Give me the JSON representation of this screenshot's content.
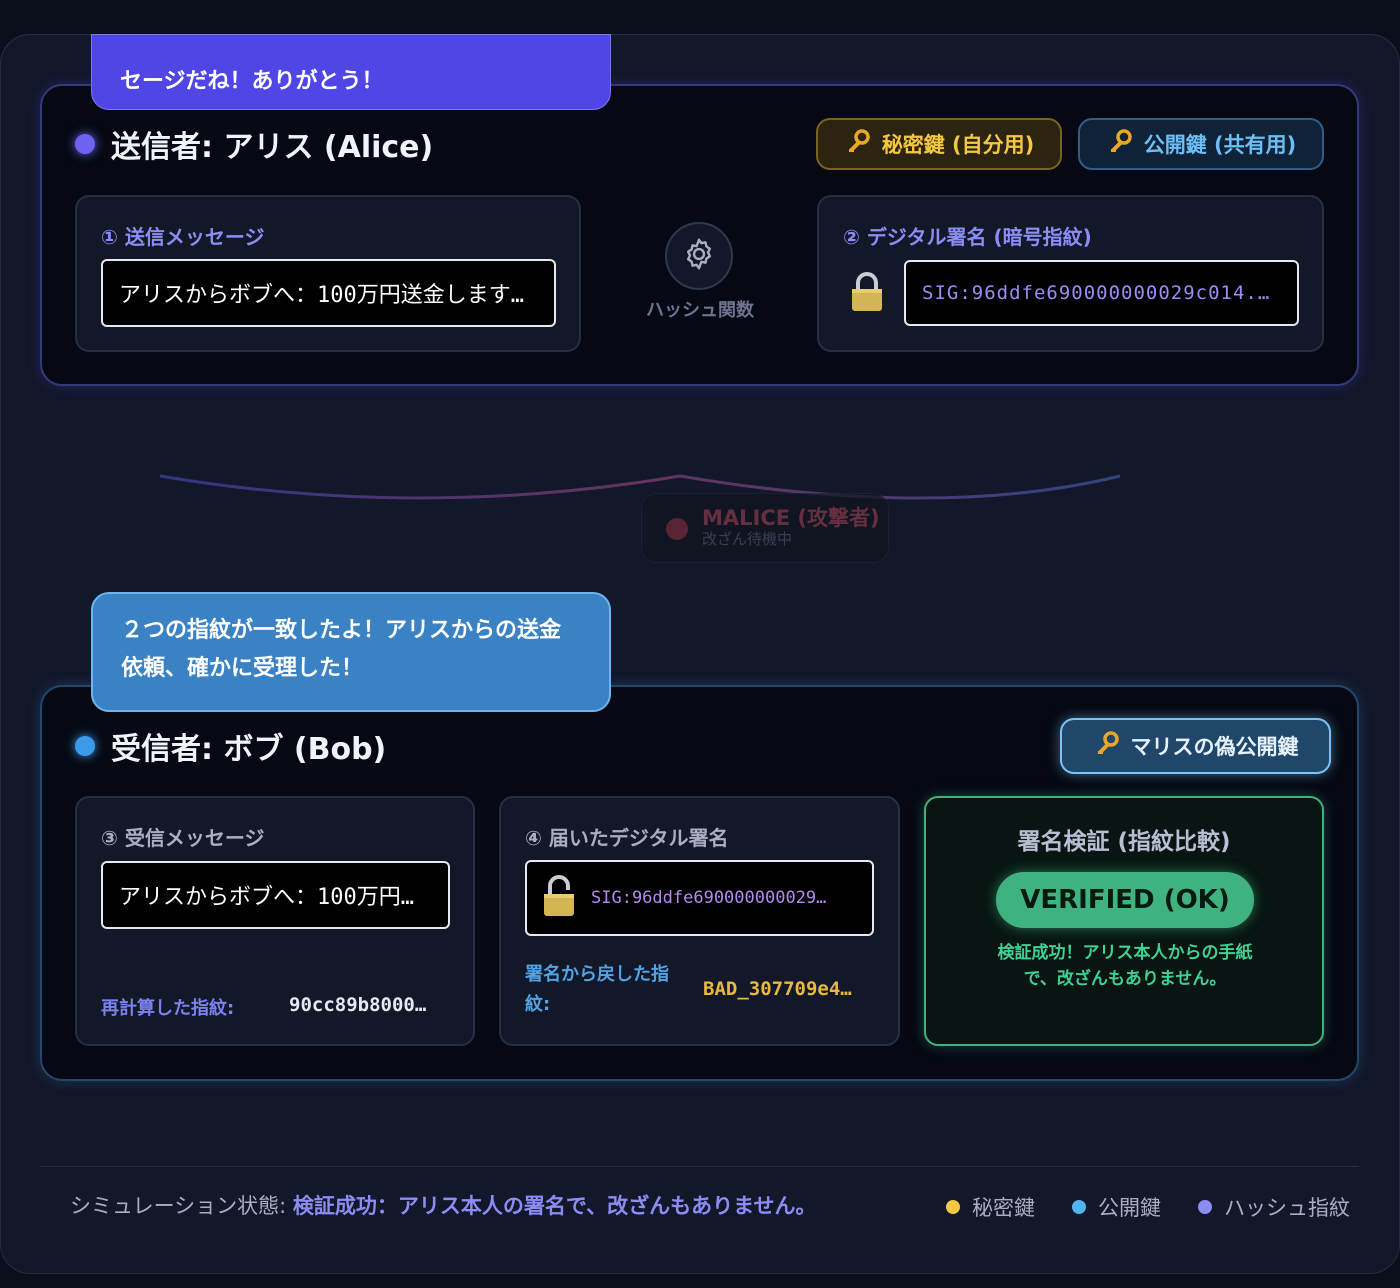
{
  "sender": {
    "bubble": "セージだね！ありがとう！",
    "title": "送信者: アリス (Alice)",
    "secret_key_badge": "秘密鍵 (自分用)",
    "public_key_badge": "公開鍵 (共有用)",
    "message_label": "① 送信メッセージ",
    "message_value": "アリスからボブへ：100万円送金します…",
    "hash_label": "ハッシュ関数",
    "signature_label": "② デジタル署名 (暗号指紋)",
    "signature_value": "SIG:96ddfe690000000029c014..."
  },
  "malice": {
    "name": "MALICE (攻撃者)",
    "state": "改ざん待機中"
  },
  "receiver": {
    "bubble": "２つの指紋が一致したよ！アリスからの送金依頼、確かに受理した！",
    "title": "受信者: ボブ (Bob)",
    "fake_key_badge": "マリスの偽公開鍵",
    "message_label": "③ 受信メッセージ",
    "message_value": "アリスからボブへ：100万円…",
    "recalc_label": "再計算した指紋:",
    "recalc_value": "90cc89b8000…",
    "signature_label": "④ 届いたデジタル署名",
    "signature_value": "SIG:96ddfe690000000029…",
    "restored_label": "署名から戻した指紋:",
    "restored_value": "BAD_307709e4…",
    "verify_title": "署名検証 (指紋比較)",
    "verify_status": "VERIFIED (OK)",
    "verify_message": "検証成功！アリス本人からの手紙で、改ざんもありません。"
  },
  "footer": {
    "status_label": "シミュレーション状態:",
    "status_value": "検証成功：アリス本人の署名で、改ざんもありません。",
    "legend": [
      {
        "label": "秘密鍵",
        "color": "#f5c842"
      },
      {
        "label": "公開鍵",
        "color": "#4fb3f0"
      },
      {
        "label": "ハッシュ指紋",
        "color": "#8b8df5"
      }
    ]
  },
  "icons": {
    "key": "key-icon",
    "lock": "lock-icon",
    "gear": "gear-icon"
  }
}
